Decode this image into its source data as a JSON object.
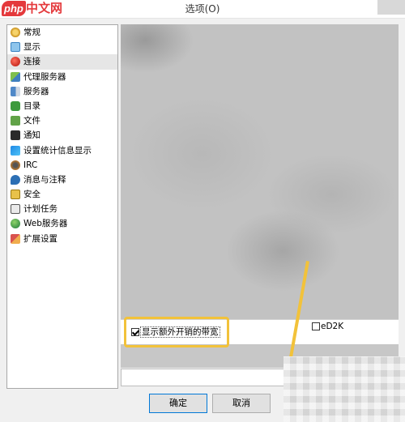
{
  "window": {
    "title": "选项(O)",
    "logo_prefix": "php",
    "logo_suffix": "中文网"
  },
  "tree": {
    "items": [
      {
        "label": "常规",
        "icon": "gear-icon"
      },
      {
        "label": "显示",
        "icon": "display-icon"
      },
      {
        "label": "连接",
        "icon": "connection-icon",
        "selected": true
      },
      {
        "label": "代理服务器",
        "icon": "proxy-icon"
      },
      {
        "label": "服务器",
        "icon": "server-icon"
      },
      {
        "label": "目录",
        "icon": "folder-icon"
      },
      {
        "label": "文件",
        "icon": "file-icon"
      },
      {
        "label": "通知",
        "icon": "notification-icon"
      },
      {
        "label": "设置统计信息显示",
        "icon": "statistics-icon"
      },
      {
        "label": "IRC",
        "icon": "irc-icon"
      },
      {
        "label": "消息与注释",
        "icon": "message-icon"
      },
      {
        "label": "安全",
        "icon": "lock-icon"
      },
      {
        "label": "计划任务",
        "icon": "schedule-icon"
      },
      {
        "label": "Web服务器",
        "icon": "globe-icon"
      },
      {
        "label": "扩展设置",
        "icon": "extension-icon"
      }
    ]
  },
  "content": {
    "show_overhead_label": "显示额外开销的带宽",
    "show_overhead_checked": true,
    "ed2k_label": "eD2K",
    "ed2k_checked": false
  },
  "buttons": {
    "ok": "确定",
    "cancel": "取消"
  },
  "colors": {
    "highlight": "#f2c23a",
    "logo": "#e4393c"
  }
}
